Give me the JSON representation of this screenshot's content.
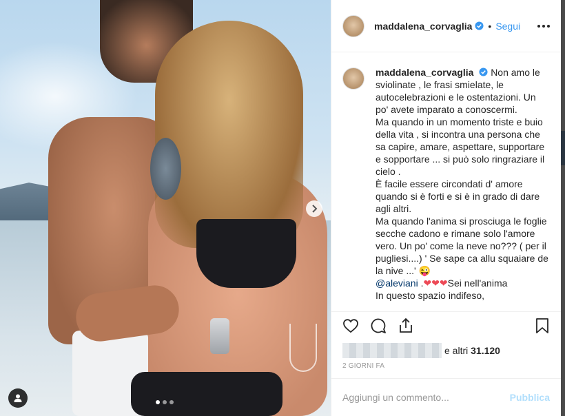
{
  "post": {
    "username": "maddalena_corvaglia",
    "follow_label": "Segui",
    "separator": "•",
    "caption": {
      "username": "maddalena_corvaglia",
      "lines": [
        "Non amo le sviolinate , le frasi smielate, le autocelebrazioni e le ostentazioni. Un po' avete imparato a conoscermi.",
        "Ma quando in un momento triste e buio della vita , si incontra una persona che sa capire, amare, aspettare, supportare e sopportare ... si può solo ringraziare il cielo .",
        "È facile essere circondati d' amore quando si è forti e si è in grado di dare agli altri.",
        "Ma quando l'anima si prosciuga le foglie secche cadono e rimane solo l'amore vero. Un po' come la neve no??? ( per il pugliesi....) ' Se sape ca allu squaiare de la nive ...' 😜"
      ],
      "mention": "@aleviani",
      "mention_suffix": " .",
      "hearts": "❤❤❤",
      "after_hearts": "Sei nell'anima",
      "last_line": "In questo spazio indifeso,"
    },
    "likes_suffix": "e altri",
    "likes_count": "31.120",
    "timestamp": "2 GIORNI FA",
    "comment_placeholder": "Aggiungi un commento...",
    "publish_label": "Pubblica",
    "carousel": {
      "total": 3,
      "current": 1
    }
  },
  "icons": {
    "verified": "verified-badge-icon",
    "more": "more-options-icon",
    "like": "heart-icon",
    "comment": "comment-icon",
    "share": "share-icon",
    "save": "bookmark-icon",
    "next": "chevron-right-icon",
    "tags": "user-tag-icon"
  },
  "colors": {
    "accent": "#3897f0",
    "publish_disabled": "#b2dffc",
    "hearts": "#ed4956"
  }
}
